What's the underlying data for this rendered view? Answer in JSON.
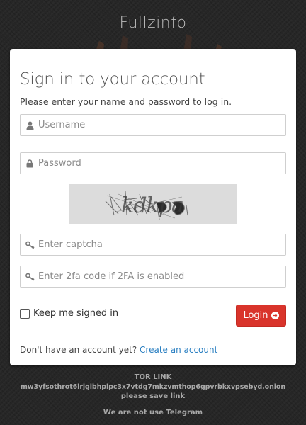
{
  "brand": "Fullzinfo",
  "card": {
    "title": "Sign in to your account",
    "subtitle": "Please enter your name and password to log in.",
    "username_placeholder": "Username",
    "password_placeholder": "Password",
    "captcha_text": "kdkpa",
    "captcha_input_placeholder": "Enter captcha",
    "twofa_placeholder": "Enter 2fa code if 2FA is enabled",
    "keep_signed_in_label": "Keep me signed in",
    "keep_signed_in_checked": false,
    "login_label": "Login",
    "signup_prompt": "Don't have an account yet?",
    "signup_link": "Create an account"
  },
  "footer": {
    "tor_heading": "TOR LINK",
    "tor_address": "mw3yfsothrot6lrjgibhplpc3x7vtdg7mkzvmthop6gpvrbkxvpsebyd.onion",
    "save_note": "please save link",
    "telegram_note": "We are not use Telegram"
  },
  "colors": {
    "background": "#262626",
    "login_button": "#d9342b",
    "link": "#2a7fc1"
  },
  "icons": {
    "username": "user-icon",
    "password": "lock-icon",
    "captcha": "key-icon",
    "twofa": "key-icon",
    "login": "arrow-circle-right-icon"
  }
}
